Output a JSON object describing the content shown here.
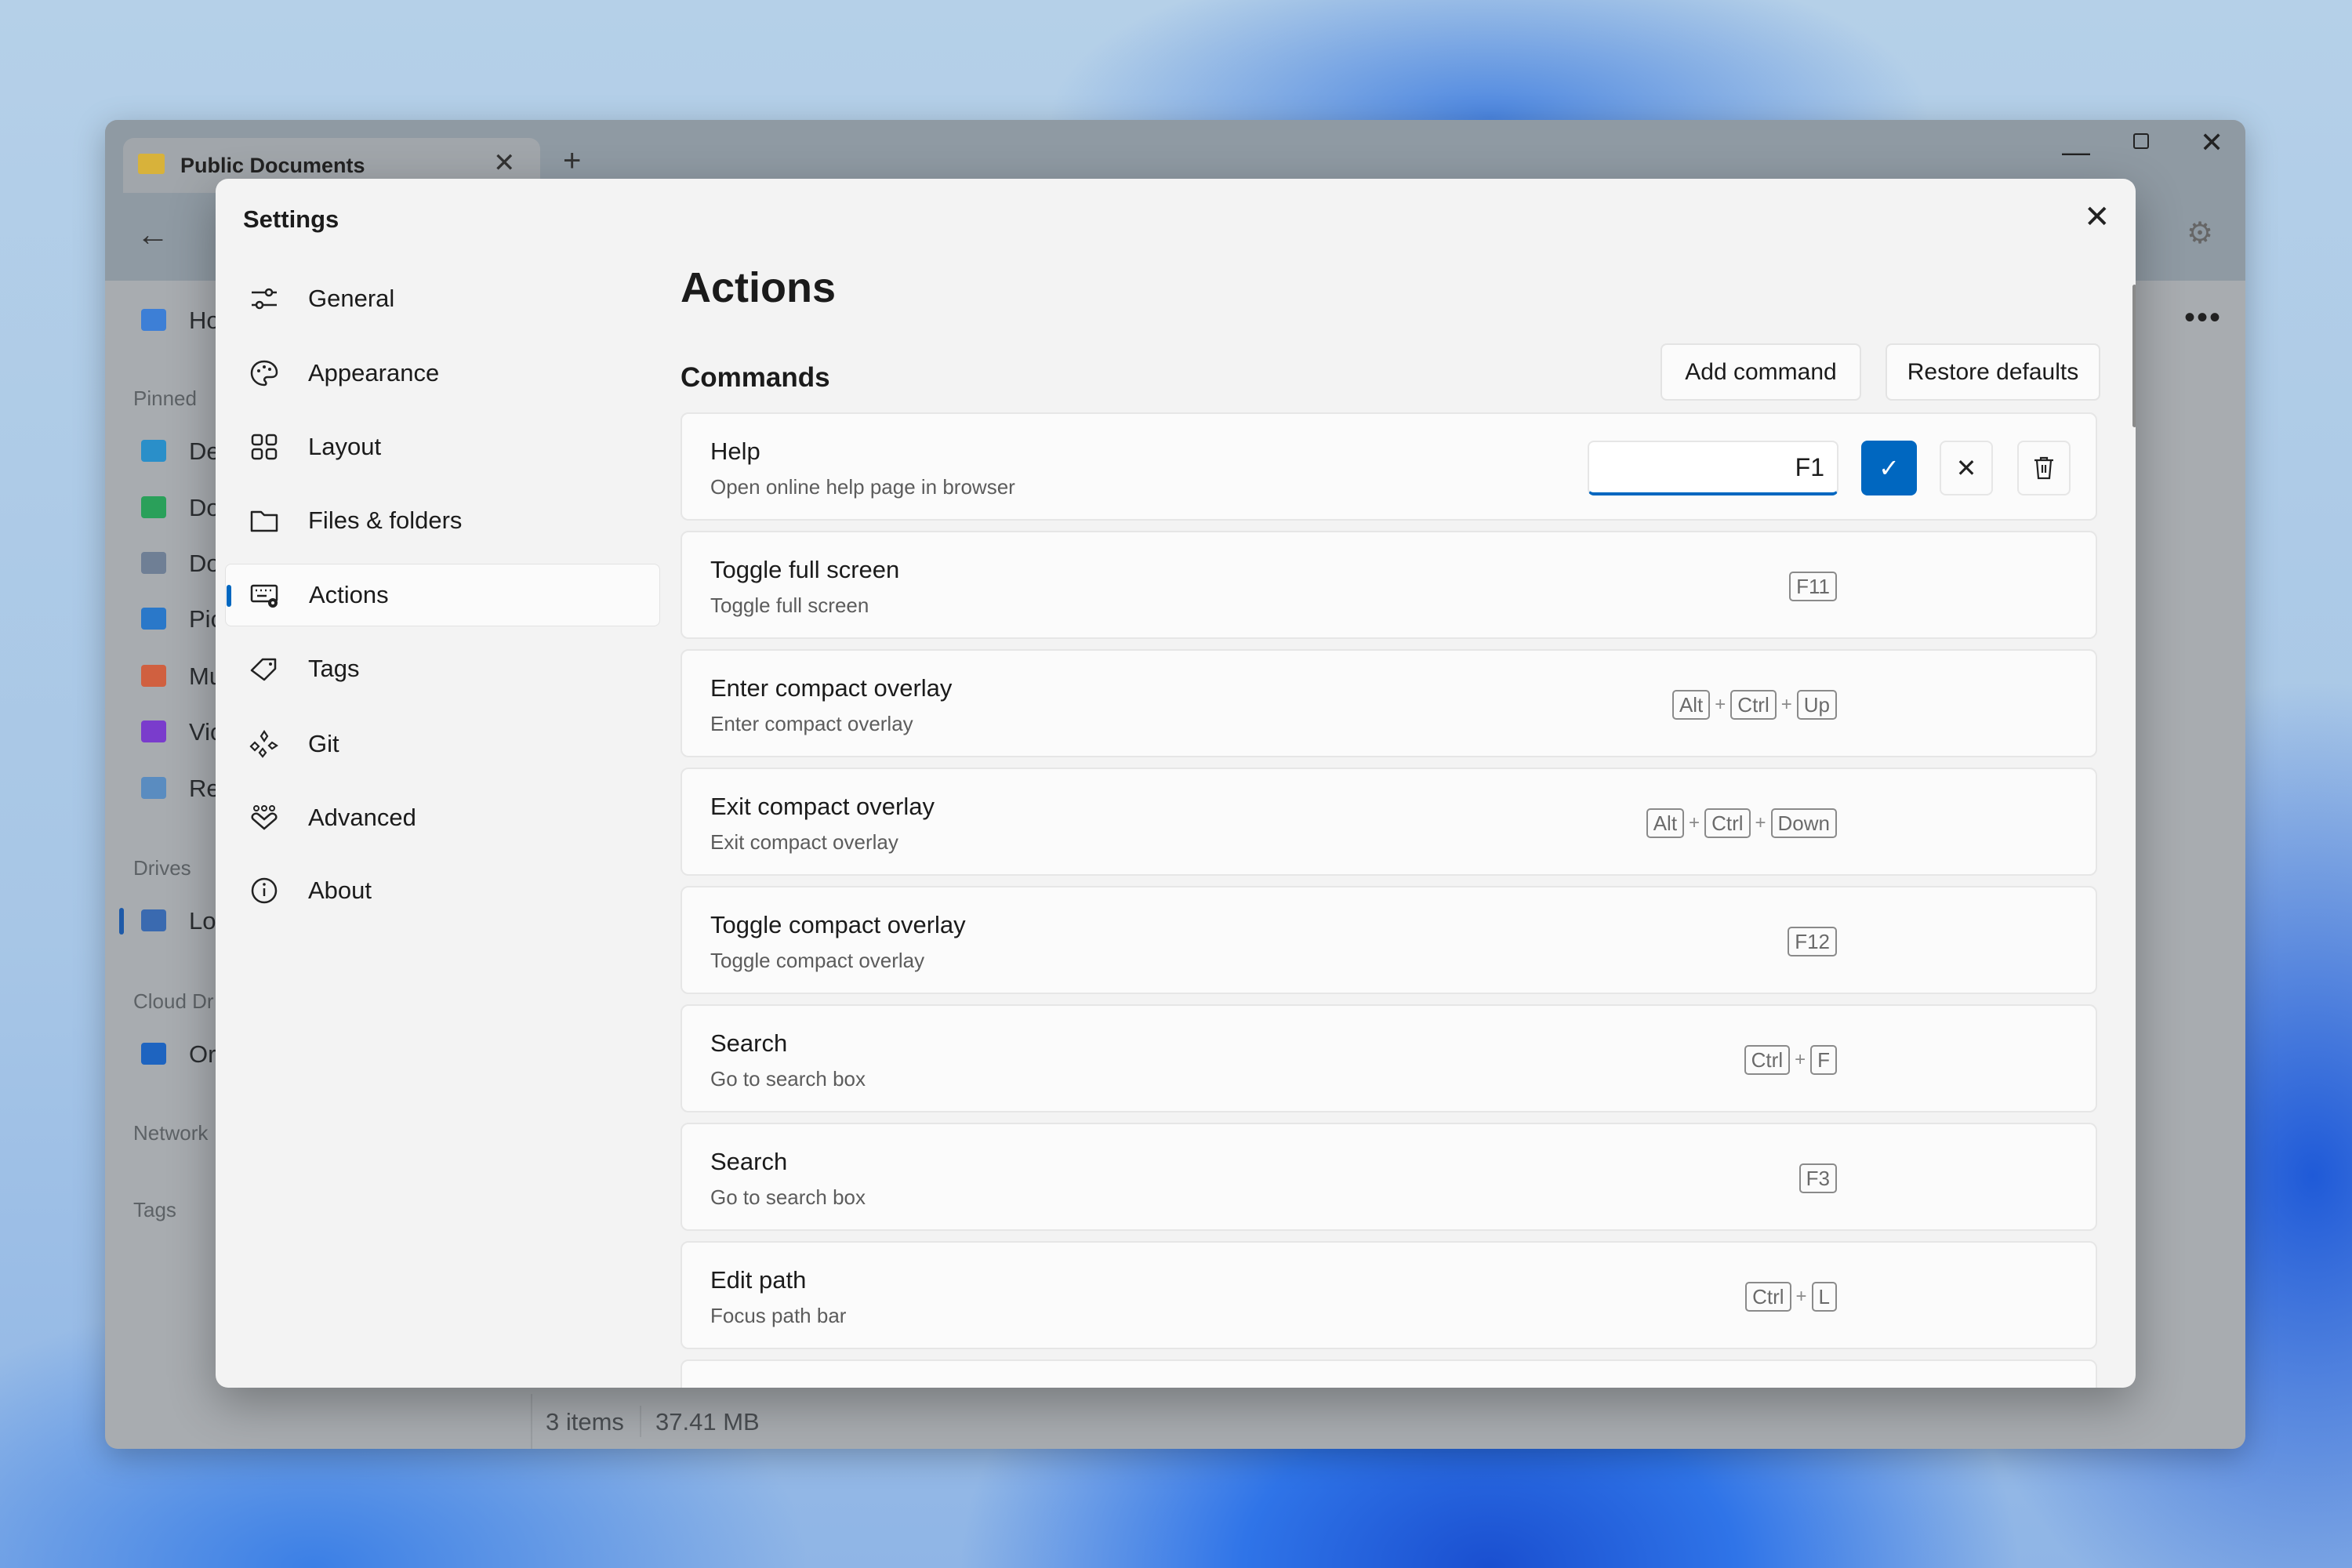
{
  "explorer": {
    "tab_title": "Public Documents",
    "sidebar": [
      {
        "label": "Ho",
        "icon": "home-icon",
        "kind": "item"
      },
      {
        "label": "Pinned",
        "kind": "header"
      },
      {
        "label": "De",
        "icon": "desktop-icon",
        "kind": "item"
      },
      {
        "label": "Do",
        "icon": "downloads-icon",
        "kind": "item"
      },
      {
        "label": "Do",
        "icon": "documents-icon",
        "kind": "item"
      },
      {
        "label": "Pic",
        "icon": "pictures-icon",
        "kind": "item"
      },
      {
        "label": "Mu",
        "icon": "music-icon",
        "kind": "item"
      },
      {
        "label": "Vic",
        "icon": "videos-icon",
        "kind": "item"
      },
      {
        "label": "Re",
        "icon": "recycle-bin-icon",
        "kind": "item"
      },
      {
        "label": "Drives",
        "kind": "header"
      },
      {
        "label": "Lo",
        "icon": "local-disk-icon",
        "kind": "item"
      },
      {
        "label": "Cloud Dr",
        "kind": "header"
      },
      {
        "label": "Or",
        "icon": "onedrive-icon",
        "kind": "item"
      },
      {
        "label": "Network",
        "kind": "header"
      },
      {
        "label": "Tags",
        "kind": "header"
      }
    ],
    "status": {
      "items": "3 items",
      "size": "37.41 MB"
    }
  },
  "settings": {
    "title": "Settings",
    "nav": [
      {
        "label": "General",
        "icon": "sliders-icon"
      },
      {
        "label": "Appearance",
        "icon": "palette-icon"
      },
      {
        "label": "Layout",
        "icon": "grid-icon"
      },
      {
        "label": "Files & folders",
        "icon": "folder-icon"
      },
      {
        "label": "Actions",
        "icon": "keyboard-gear-icon",
        "selected": true
      },
      {
        "label": "Tags",
        "icon": "tag-icon"
      },
      {
        "label": "Git",
        "icon": "git-icon"
      },
      {
        "label": "Advanced",
        "icon": "advanced-icon"
      },
      {
        "label": "About",
        "icon": "info-icon"
      }
    ],
    "page_title": "Actions",
    "section_title": "Commands",
    "add_command": "Add command",
    "restore_defaults": "Restore defaults",
    "editing": {
      "value": "F1"
    },
    "accent": "#0067c0",
    "commands": [
      {
        "title": "Help",
        "desc": "Open online help page in browser",
        "keys": [],
        "editing": true
      },
      {
        "title": "Toggle full screen",
        "desc": "Toggle full screen",
        "keys": [
          "F11"
        ]
      },
      {
        "title": "Enter compact overlay",
        "desc": "Enter compact overlay",
        "keys": [
          "Alt",
          "Ctrl",
          "Up"
        ]
      },
      {
        "title": "Exit compact overlay",
        "desc": "Exit compact overlay",
        "keys": [
          "Alt",
          "Ctrl",
          "Down"
        ]
      },
      {
        "title": "Toggle compact overlay",
        "desc": "Toggle compact overlay",
        "keys": [
          "F12"
        ]
      },
      {
        "title": "Search",
        "desc": "Go to search box",
        "keys": [
          "Ctrl",
          "F"
        ]
      },
      {
        "title": "Search",
        "desc": "Go to search box",
        "keys": [
          "F3"
        ]
      },
      {
        "title": "Edit path",
        "desc": "Focus path bar",
        "keys": [
          "Ctrl",
          "L"
        ]
      },
      {
        "title": "",
        "desc": "",
        "keys": []
      }
    ],
    "key_separator": "+"
  }
}
